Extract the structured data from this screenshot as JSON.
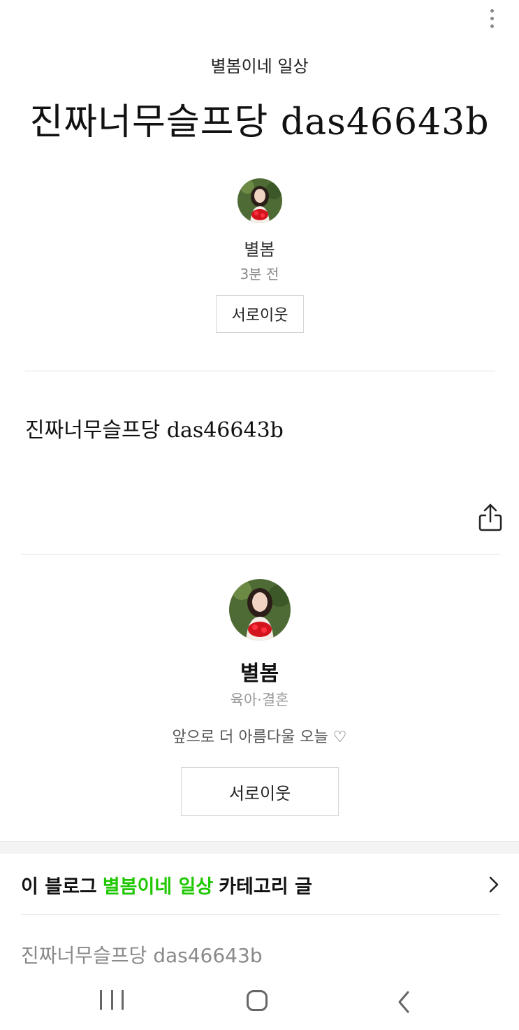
{
  "header": {
    "category": "별봄이네 일상",
    "title": "진짜너무슬프당 das46643b",
    "more_icon": "more-vertical-icon"
  },
  "author": {
    "name": "별봄",
    "time": "3분 전",
    "neighbor_button": "서로이웃"
  },
  "post": {
    "body": "진짜너무슬프당 das46643b",
    "share_icon": "share-icon"
  },
  "profile": {
    "name": "별봄",
    "topic": "육아·결혼",
    "bio": "앞으로 더 아름다울 오늘 ♡",
    "neighbor_button": "서로이웃"
  },
  "category_link": {
    "prefix": "이 블로그",
    "blog_name": "별봄이네 일상",
    "suffix": "카테고리 글",
    "accent_color": "#1ec800"
  },
  "related": {
    "items": [
      "진짜너무슬프당 das46643b"
    ]
  },
  "nav": {
    "recent_icon": "recent-apps-icon",
    "home_icon": "home-icon",
    "back_icon": "back-icon"
  }
}
